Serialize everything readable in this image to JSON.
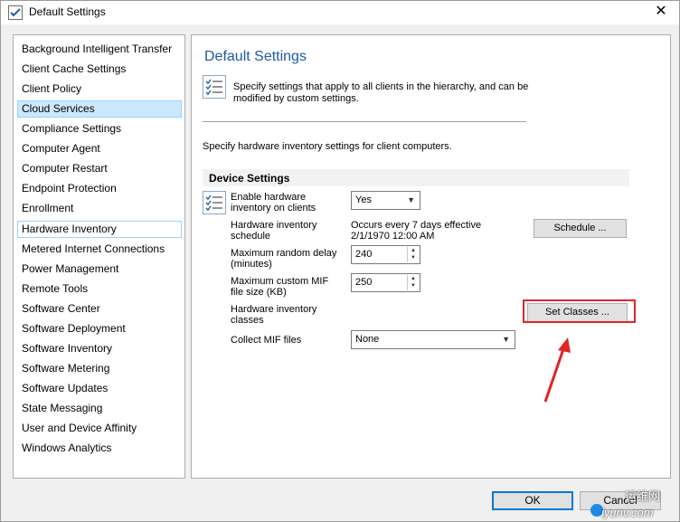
{
  "window": {
    "title": "Default Settings",
    "close_glyph": "✕"
  },
  "sidebar": {
    "items": [
      {
        "label": "Background Intelligent Transfer"
      },
      {
        "label": "Client Cache Settings"
      },
      {
        "label": "Client Policy"
      },
      {
        "label": "Cloud Services",
        "selected": true
      },
      {
        "label": "Compliance Settings"
      },
      {
        "label": "Computer Agent"
      },
      {
        "label": "Computer Restart"
      },
      {
        "label": "Endpoint Protection"
      },
      {
        "label": "Enrollment"
      },
      {
        "label": "Hardware Inventory",
        "focused": true
      },
      {
        "label": "Metered Internet Connections"
      },
      {
        "label": "Power Management"
      },
      {
        "label": "Remote Tools"
      },
      {
        "label": "Software Center"
      },
      {
        "label": "Software Deployment"
      },
      {
        "label": "Software Inventory"
      },
      {
        "label": "Software Metering"
      },
      {
        "label": "Software Updates"
      },
      {
        "label": "State Messaging"
      },
      {
        "label": "User and Device Affinity"
      },
      {
        "label": "Windows Analytics"
      }
    ]
  },
  "main": {
    "heading": "Default Settings",
    "description": "Specify settings that apply to all clients in the hierarchy, and can be modified by custom settings.",
    "intro": "Specify hardware inventory settings for client computers.",
    "section_title": "Device Settings",
    "enable_label": "Enable hardware inventory on clients",
    "enable_value": "Yes",
    "schedule_label": "Hardware inventory schedule",
    "schedule_value_line1": "Occurs every 7 days effective",
    "schedule_value_line2": "2/1/1970 12:00 AM",
    "schedule_button": "Schedule ...",
    "random_delay_label": "Maximum random delay (minutes)",
    "random_delay_value": "240",
    "mif_size_label": "Maximum custom MIF file size (KB)",
    "mif_size_value": "250",
    "classes_label": "Hardware inventory classes",
    "set_classes_button": "Set Classes ...",
    "collect_mif_label": "Collect MIF files",
    "collect_mif_value": "None"
  },
  "footer": {
    "ok_label": "OK",
    "cancel_label": "Cancel"
  },
  "watermark": {
    "line1": "运维网",
    "line2": "iyunv.com"
  },
  "colors": {
    "heading": "#1e5aa8",
    "highlight_box": "#e02424",
    "selection": "#cce8ff",
    "ok_border": "#0078d7"
  },
  "icons": {
    "title": "settings-checklist-icon",
    "description": "checklist-icon",
    "row": "checklist-icon",
    "arrow": "red-arrow-annotation"
  }
}
